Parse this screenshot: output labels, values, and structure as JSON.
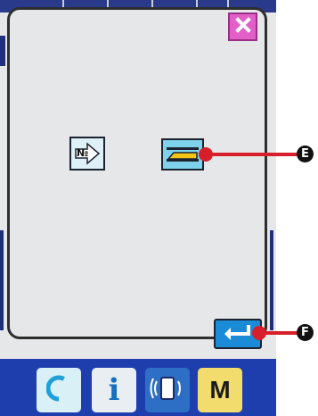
{
  "dialog": {
    "close_button": {
      "icon": "close-icon",
      "color": "#e25fc7"
    },
    "number_button": {
      "label": "№",
      "icon": "number-icon"
    },
    "reader_button": {
      "icon": "card-reader-icon"
    },
    "enter_button": {
      "icon": "enter-icon",
      "color": "#1b8bd8"
    }
  },
  "callouts": {
    "e": {
      "label": "E"
    },
    "f": {
      "label": "F"
    }
  },
  "bottom_bar": {
    "items": [
      {
        "icon": "reset-icon"
      },
      {
        "label": "i",
        "icon": "info-icon"
      },
      {
        "icon": "communication-icon"
      },
      {
        "label": "M",
        "icon": "mode-icon"
      }
    ]
  }
}
